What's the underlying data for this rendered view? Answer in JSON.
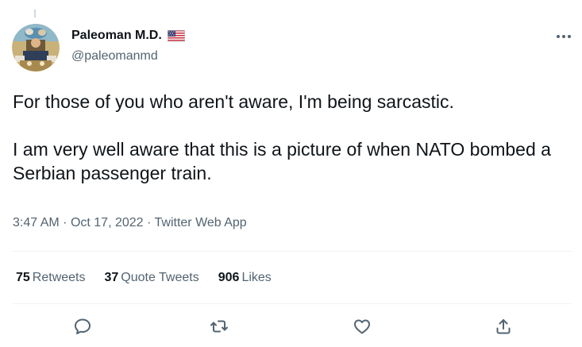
{
  "author": {
    "display_name": "Paleoman M.D.",
    "handle": "@paleomanmd",
    "flag_icon": "us-flag-icon"
  },
  "tweet": {
    "paragraphs": [
      "For those of you who aren't aware, I'm being sarcastic.",
      "I am very well aware that this is a picture of when NATO bombed a Serbian passenger train."
    ],
    "time": "3:47 AM",
    "date": "Oct 17, 2022",
    "source": "Twitter Web App",
    "separator": "·"
  },
  "stats": {
    "retweets_count": "75",
    "retweets_label": "Retweets",
    "quote_tweets_count": "37",
    "quote_tweets_label": "Quote Tweets",
    "likes_count": "906",
    "likes_label": "Likes"
  },
  "actions": [
    "reply-icon",
    "retweet-icon",
    "like-icon",
    "share-icon"
  ],
  "colors": {
    "text_primary": "#0f1419",
    "text_secondary": "#536471",
    "divider": "#eff3f4",
    "icon": "#536471"
  }
}
